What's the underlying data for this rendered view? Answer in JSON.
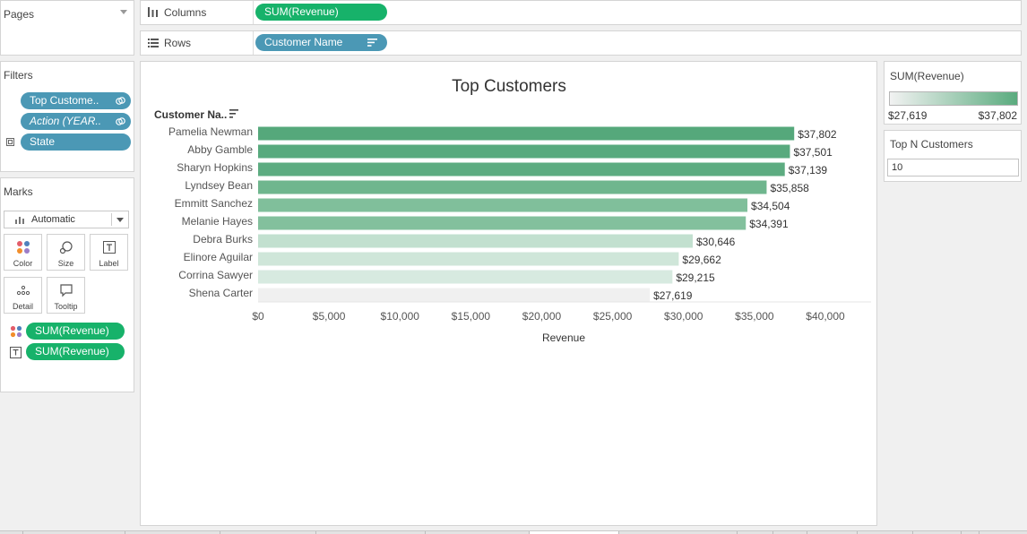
{
  "pages": {
    "title": "Pages"
  },
  "filters": {
    "title": "Filters",
    "items": [
      {
        "label": "Top Custome.."
      },
      {
        "label": "Action (YEAR.."
      },
      {
        "label": "State"
      }
    ]
  },
  "marks": {
    "title": "Marks",
    "mark_type": "Automatic",
    "buttons": {
      "color": "Color",
      "size": "Size",
      "label": "Label",
      "detail": "Detail",
      "tooltip": "Tooltip"
    },
    "fields": [
      {
        "label": "SUM(Revenue)",
        "encoding": "color"
      },
      {
        "label": "SUM(Revenue)",
        "encoding": "label"
      }
    ]
  },
  "shelves": {
    "columns": {
      "label": "Columns",
      "pill": "SUM(Revenue)"
    },
    "rows": {
      "label": "Rows",
      "pill": "Customer Name"
    }
  },
  "legend": {
    "title": "SUM(Revenue)",
    "min": "$27,619",
    "max": "$37,802",
    "color_low": "#f2f2f2",
    "color_high": "#5aab7e"
  },
  "parameter": {
    "title": "Top N Customers",
    "value": "10"
  },
  "chart_data": {
    "type": "bar",
    "orientation": "horizontal",
    "title": "Top Customers",
    "ylabel": "Customer Na..",
    "xlabel": "Revenue",
    "categories": [
      "Pamelia Newman",
      "Abby Gamble",
      "Sharyn Hopkins",
      "Lyndsey Bean",
      "Emmitt Sanchez",
      "Melanie Hayes",
      "Debra Burks",
      "Elinore Aguilar",
      "Corrina Sawyer",
      "Shena Carter"
    ],
    "values": [
      37802,
      37501,
      37139,
      35858,
      34504,
      34391,
      30646,
      29662,
      29215,
      27619
    ],
    "data_labels": [
      "$37,802",
      "$37,501",
      "$37,139",
      "$35,858",
      "$34,504",
      "$34,391",
      "$30,646",
      "$29,662",
      "$29,215",
      "$27,619"
    ],
    "bar_colors": [
      "#55a87b",
      "#58aa7e",
      "#5dac81",
      "#6fb68e",
      "#80bf9b",
      "#83c09d",
      "#c2e0cf",
      "#cfe6d9",
      "#d7eae0",
      "#f0f0f0"
    ],
    "xlim": [
      0,
      40000
    ],
    "xticks": [
      0,
      5000,
      10000,
      15000,
      20000,
      25000,
      30000,
      35000,
      40000
    ],
    "xtick_labels": [
      "$0",
      "$5,000",
      "$10,000",
      "$15,000",
      "$20,000",
      "$25,000",
      "$30,000",
      "$35,000",
      "$40,000"
    ],
    "grid": false
  }
}
